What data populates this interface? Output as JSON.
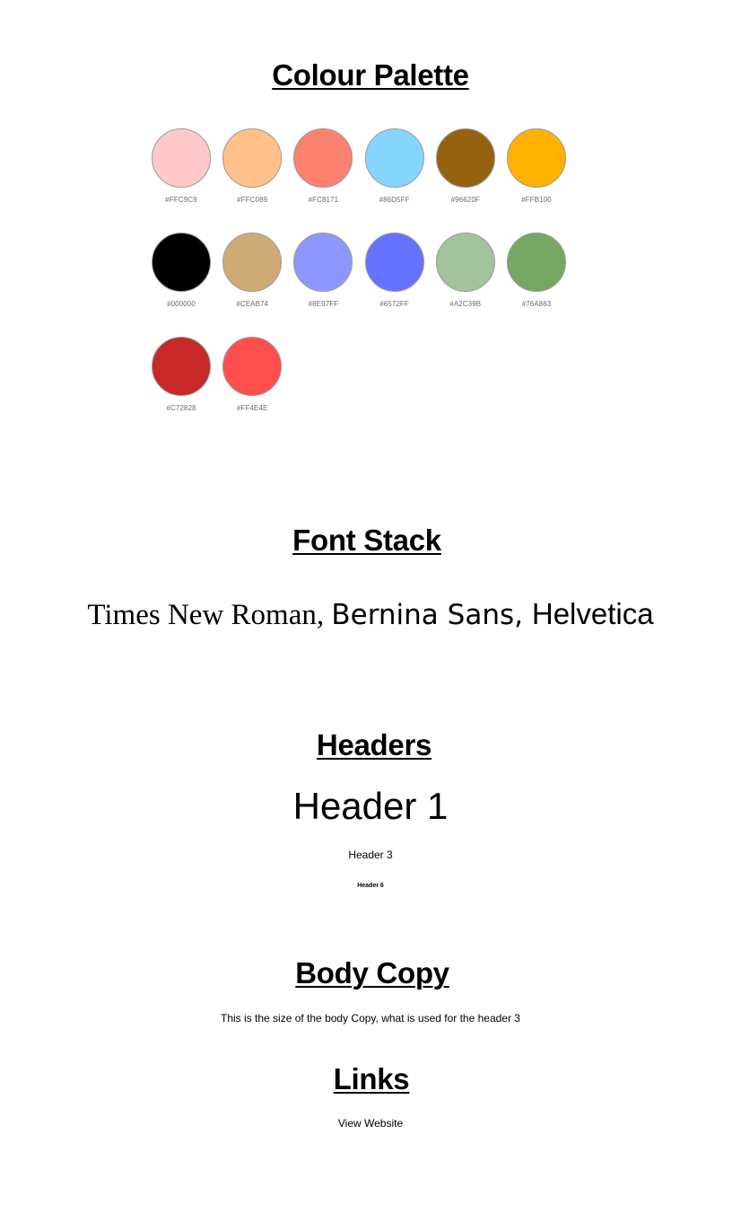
{
  "sections": {
    "palette_title": "Colour Palette",
    "fonts_title": "Font Stack",
    "headers_title": "Headers",
    "body_title": "Body Copy",
    "links_title": "Links"
  },
  "palette": [
    {
      "hex": "#FFC9C9",
      "color": "#FFC9C9"
    },
    {
      "hex": "#FFC089",
      "color": "#FFC089"
    },
    {
      "hex": "#FC8171",
      "color": "#FC8171"
    },
    {
      "hex": "#86D5FF",
      "color": "#86D5FF"
    },
    {
      "hex": "#96620F",
      "color": "#96620F"
    },
    {
      "hex": "#FFB100",
      "color": "#FFB100"
    },
    {
      "hex": "#000000",
      "color": "#000000"
    },
    {
      "hex": "#CEAB74",
      "color": "#CEAB74"
    },
    {
      "hex": "#8E97FF",
      "color": "#8E97FF"
    },
    {
      "hex": "#6572FF",
      "color": "#6572FF"
    },
    {
      "hex": "#A2C39B",
      "color": "#A2C39B"
    },
    {
      "hex": "#76A863",
      "color": "#76A863"
    },
    {
      "hex": "#C72828",
      "color": "#C72828"
    },
    {
      "hex": "#FF4E4E",
      "color": "#FF4E4E"
    }
  ],
  "fonts": {
    "serif": "Times New Roman",
    "sans": "Bernina Sans",
    "helvetica": "Helvetica",
    "separator": ", "
  },
  "headers": {
    "h1": "Header 1",
    "h3": "Header 3",
    "h6": "Header 6"
  },
  "body": {
    "text": "This is the size of the body Copy, what is used for the header 3"
  },
  "links": {
    "view_website": "View Website"
  }
}
